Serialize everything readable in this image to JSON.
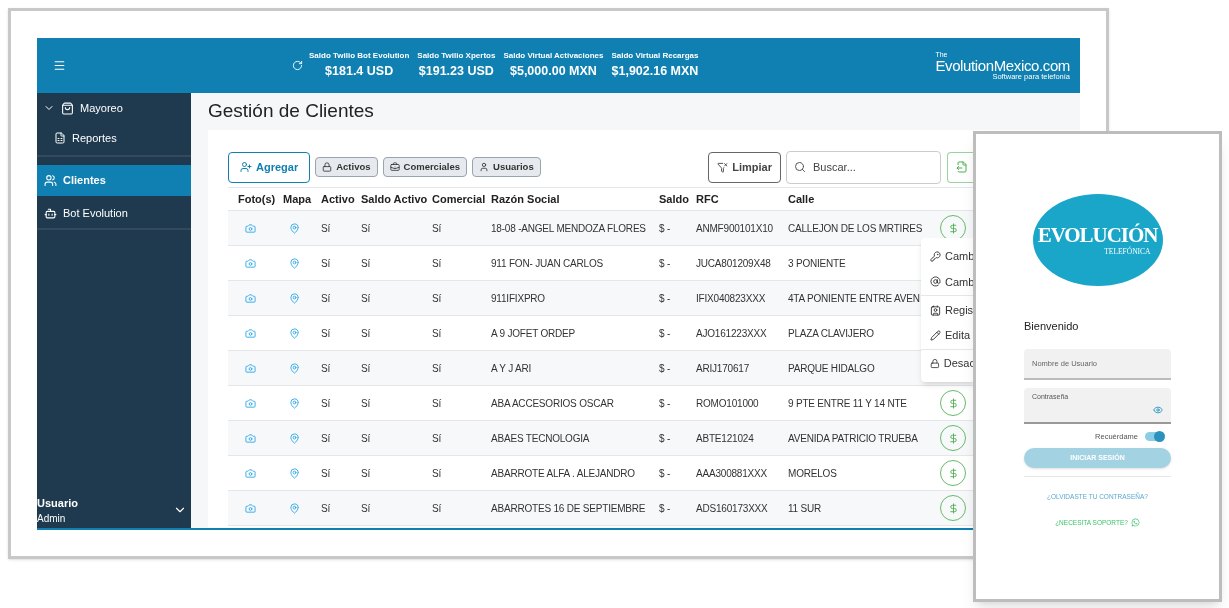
{
  "app": {
    "header": {
      "balances": [
        {
          "label": "Saldo Twilio Bot Evolution",
          "value": "$181.4 USD"
        },
        {
          "label": "Saldo Twilio Xpertos",
          "value": "$191.23 USD"
        },
        {
          "label": "Saldo Virtual Activaciones",
          "value": "$5,000.00 MXN"
        },
        {
          "label": "Saldo Virtual Recargas",
          "value": "$1,902.16 MXN"
        }
      ],
      "logo": {
        "prefix": "The",
        "name": "EvolutionMexico.com",
        "tagline": "Software para telefonía"
      }
    },
    "sidebar": {
      "items": [
        {
          "label": "Mayoreo",
          "expanded": true,
          "selected": false,
          "children": [
            {
              "label": "Reportes",
              "selected": false
            }
          ]
        },
        {
          "label": "Clientes",
          "selected": true
        },
        {
          "label": "Bot Evolution",
          "selected": false
        }
      ],
      "user": {
        "name": "Usuario",
        "role": "Admin"
      }
    },
    "page_title": "Gestión de Clientes",
    "toolbar": {
      "add": "Agregar",
      "filters": [
        "Activos",
        "Comerciales",
        "Usuarios"
      ],
      "clear": "Limpiar",
      "search": {
        "placeholder": "Buscar..."
      }
    },
    "table": {
      "columns": [
        "Foto(s)",
        "Mapa",
        "Activo",
        "Saldo Activo",
        "Comercial",
        "Razón Social",
        "Saldo",
        "RFC",
        "Calle"
      ],
      "rows": [
        {
          "activo": "Sí",
          "saldo_activo": "Sí",
          "comercial": "Sí",
          "razon_social": "18-08 -ANGEL MENDOZA FLORES",
          "saldo": "$ -",
          "rfc": "ANMF900101X10",
          "calle": "CALLEJON DE LOS MRTIRES"
        },
        {
          "activo": "Sí",
          "saldo_activo": "Sí",
          "comercial": "Sí",
          "razon_social": "911 FON- JUAN CARLOS",
          "saldo": "$ -",
          "rfc": "JUCA801209X48",
          "calle": "3 PONIENTE"
        },
        {
          "activo": "Sí",
          "saldo_activo": "Sí",
          "comercial": "Sí",
          "razon_social": "911IFIXPRO",
          "saldo": "$ -",
          "rfc": "IFIX040823XXX",
          "calle": "4TA PONIENTE ENTRE AVEN"
        },
        {
          "activo": "Sí",
          "saldo_activo": "Sí",
          "comercial": "Sí",
          "razon_social": "A 9 JOFET ORDEP",
          "saldo": "$ -",
          "rfc": "AJO161223XXX",
          "calle": "PLAZA CLAVIJERO"
        },
        {
          "activo": "Sí",
          "saldo_activo": "Sí",
          "comercial": "Sí",
          "razon_social": "A Y J ARI",
          "saldo": "$ -",
          "rfc": "ARIJ170617",
          "calle": "PARQUE HIDALGO"
        },
        {
          "activo": "Sí",
          "saldo_activo": "Sí",
          "comercial": "Sí",
          "razon_social": "ABA ACCESORIOS OSCAR",
          "saldo": "$ -",
          "rfc": "ROMO101000",
          "calle": "9 PTE ENTRE 11 Y 14 NTE"
        },
        {
          "activo": "Sí",
          "saldo_activo": "Sí",
          "comercial": "Sí",
          "razon_social": "ABAES TECNOLOGIA",
          "saldo": "$ -",
          "rfc": "ABTE121024",
          "calle": "AVENIDA PATRICIO TRUEBA"
        },
        {
          "activo": "Sí",
          "saldo_activo": "Sí",
          "comercial": "Sí",
          "razon_social": "ABARROTE ALFA . ALEJANDRO",
          "saldo": "$ -",
          "rfc": "AAA300881XXX",
          "calle": "MORELOS"
        },
        {
          "activo": "Sí",
          "saldo_activo": "Sí",
          "comercial": "Sí",
          "razon_social": "ABARROTES 16 DE SEPTIEMBRE",
          "saldo": "$ -",
          "rfc": "ADS160173XXX",
          "calle": "11 SUR"
        }
      ]
    },
    "context_menu": {
      "items": [
        "Camb",
        "Camb",
        "Regis",
        "Edita",
        "Desac"
      ]
    }
  },
  "login": {
    "logo": {
      "title": "EVOLUCIÓN",
      "subtitle": "TELEFÓNICA"
    },
    "greeting": "Bienvenido",
    "username": {
      "placeholder": "Nombre de Usuario"
    },
    "password": {
      "label": "Contraseña"
    },
    "remember": {
      "label": "Recuérdame",
      "on": true
    },
    "submit": "INICIAR SESIÓN",
    "forgot": "¿OLVIDASTE TU CONTRASEÑA?",
    "support": "¿NECESITA SOPORTE?"
  }
}
